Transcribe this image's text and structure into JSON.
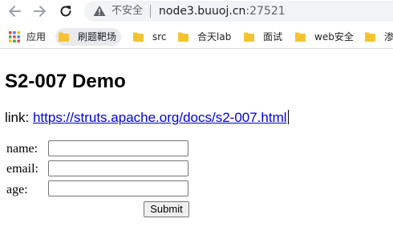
{
  "browser": {
    "security_label": "不安全",
    "url_host": "node3.buuoj.cn",
    "url_port": ":27521"
  },
  "bookmarks": [
    {
      "label": "应用",
      "icon": "apps-grid-icon"
    },
    {
      "label": "刷题靶场",
      "icon": "folder-icon"
    },
    {
      "label": "src",
      "icon": "folder-icon"
    },
    {
      "label": "合天lab",
      "icon": "folder-icon"
    },
    {
      "label": "面试",
      "icon": "folder-icon"
    },
    {
      "label": "web安全",
      "icon": "folder-icon"
    },
    {
      "label": "渗",
      "icon": "folder-icon"
    }
  ],
  "page": {
    "title": "S2-007 Demo",
    "link_prefix": "link: ",
    "link_text": "https://struts.apache.org/docs/s2-007.html"
  },
  "form": {
    "name_label": "name:",
    "email_label": "email:",
    "age_label": "age:",
    "name_value": "",
    "email_value": "",
    "age_value": "",
    "submit_label": "Submit"
  },
  "colors": {
    "link": "#0000ee",
    "folder": "#f4c430",
    "omnibox_bg": "#f1f3f4"
  }
}
